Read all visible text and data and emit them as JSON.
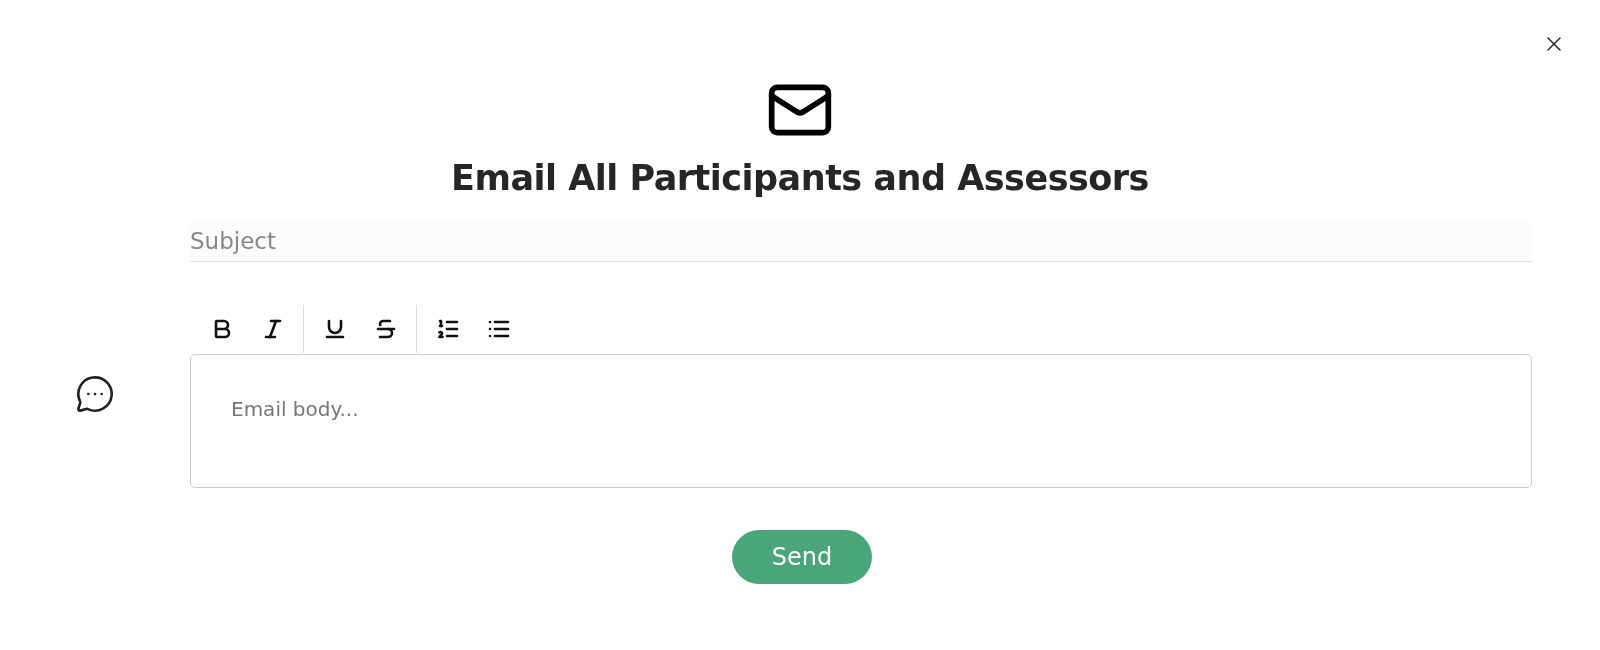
{
  "dialog": {
    "title": "Email All Participants and Assessors"
  },
  "subject": {
    "placeholder": "Subject"
  },
  "body": {
    "placeholder": "Email body..."
  },
  "send_button": "Send"
}
